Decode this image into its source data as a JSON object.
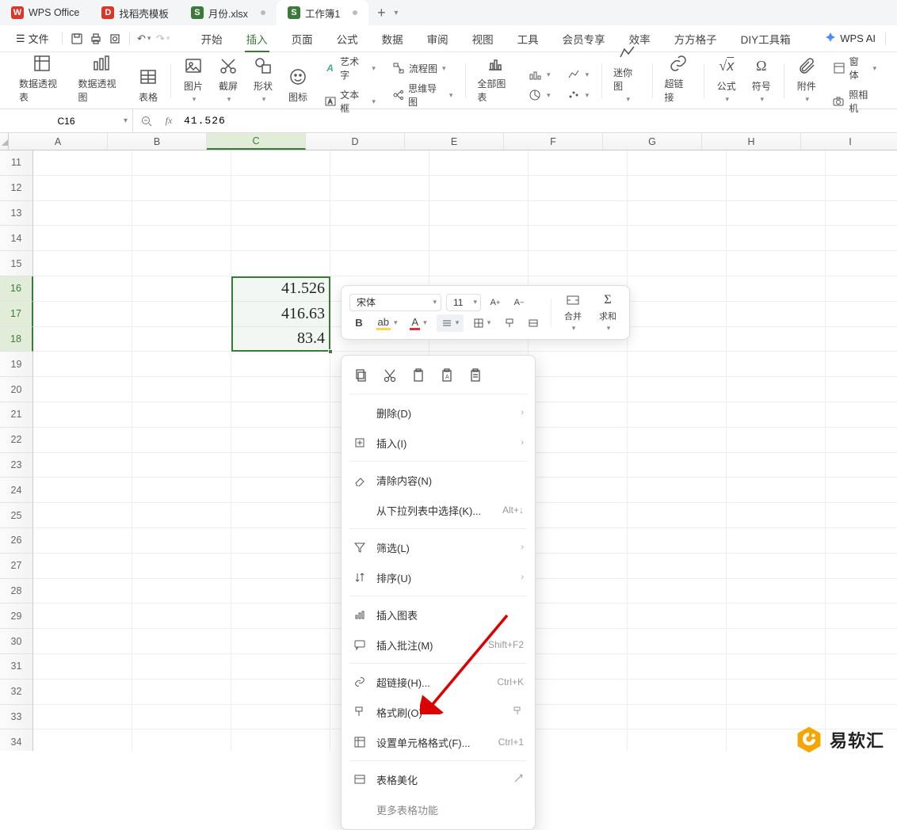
{
  "tabs": {
    "app": "WPS Office",
    "t1": "找稻壳模板",
    "t2": "月份.xlsx",
    "t3": "工作簿1"
  },
  "menu": {
    "file": "文件",
    "items": [
      "开始",
      "插入",
      "页面",
      "公式",
      "数据",
      "审阅",
      "视图",
      "工具",
      "会员专享",
      "效率",
      "方方格子",
      "DIY工具箱"
    ],
    "active_index": 1,
    "ai": "WPS AI"
  },
  "ribbon": {
    "g1": {
      "pivot_table": "数据透视表",
      "pivot_chart": "数据透视图",
      "table": "表格"
    },
    "g2": {
      "picture": "图片",
      "screenshot": "截屏",
      "shape": "形状",
      "icon": "图标",
      "art": "艺术字",
      "flow": "流程图",
      "text": "文本框",
      "mind": "思维导图"
    },
    "g3": {
      "allchart": "全部图表",
      "mini": "迷你图"
    },
    "g4": {
      "link": "超链接",
      "formula": "公式",
      "symbol": "符号"
    },
    "g5": {
      "attach": "附件",
      "window": "窗体",
      "camera": "照相机"
    }
  },
  "namebox": "C16",
  "formula": "41.526",
  "columns": [
    "A",
    "B",
    "C",
    "D",
    "E",
    "F",
    "G",
    "H",
    "I"
  ],
  "rows_start": 11,
  "rows_end": 34,
  "sel_rows": [
    16,
    17,
    18
  ],
  "cell_values": {
    "C16": "41.526",
    "C17": "416.63",
    "C18": "83.4"
  },
  "minitb": {
    "font": "宋体",
    "size": "11",
    "merge": "合并",
    "sum": "求和"
  },
  "ctx": {
    "delete": "删除(D)",
    "insert": "插入(I)",
    "clear": "清除内容(N)",
    "droplist": "从下拉列表中选择(K)...",
    "droplist_sc": "Alt+↓",
    "filter": "筛选(L)",
    "sort": "排序(U)",
    "inschart": "插入图表",
    "comment": "插入批注(M)",
    "comment_sc": "Shift+F2",
    "hyperlink": "超链接(H)...",
    "hyperlink_sc": "Ctrl+K",
    "painter": "格式刷(O)",
    "format": "设置单元格格式(F)...",
    "format_sc": "Ctrl+1",
    "beautify": "表格美化",
    "more": "更多表格功能"
  },
  "watermark": "易软汇"
}
